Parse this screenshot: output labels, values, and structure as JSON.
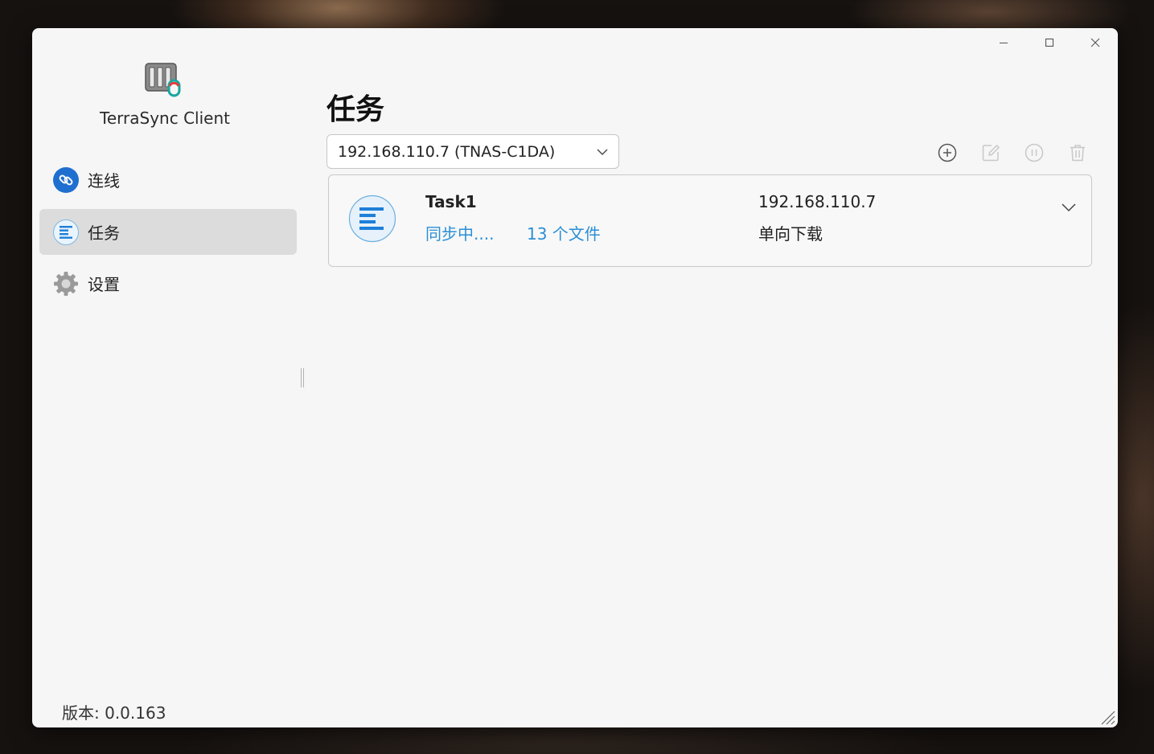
{
  "app": {
    "name": "TerraSync Client",
    "version_label": "版本: 0.0.163"
  },
  "window_controls": [
    "minimize-icon",
    "maximize-icon",
    "close-icon"
  ],
  "sidebar": {
    "items": [
      {
        "label": "连线",
        "icon": "link-icon",
        "active": false
      },
      {
        "label": "任务",
        "icon": "task-list-icon",
        "active": true
      },
      {
        "label": "设置",
        "icon": "gear-icon",
        "active": false
      }
    ]
  },
  "main": {
    "title": "任务",
    "device_select": {
      "value": "192.168.110.7 (TNAS-C1DA)"
    },
    "toolbar": [
      "add-icon",
      "edit-icon",
      "pause-icon",
      "delete-icon"
    ],
    "tasks": [
      {
        "name": "Task1",
        "status": "同步中....",
        "files": "13 个文件",
        "ip": "192.168.110.7",
        "mode": "单向下载"
      }
    ]
  },
  "colors": {
    "accent": "#2a8fd6",
    "active_nav": "#dcdcdc",
    "window_bg": "#f6f6f6"
  }
}
